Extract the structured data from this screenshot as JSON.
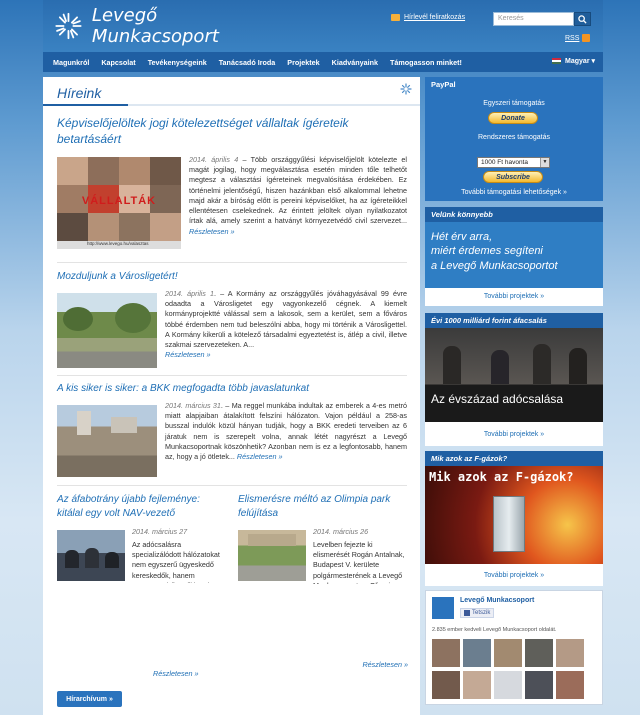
{
  "header": {
    "logo_text": "Levegő Munkacsoport",
    "newsletter": "Hírlevél feliratkozás",
    "search_placeholder": "Keresés",
    "rss": "RSS"
  },
  "nav": {
    "items": [
      "Magunkról",
      "Kapcsolat",
      "Tevékenységeink",
      "Tanácsadó Iroda",
      "Projektek",
      "Kiadványaink",
      "Támogasson minket!"
    ],
    "language": "Magyar ▾"
  },
  "main": {
    "title": "Híreink",
    "articles": [
      {
        "title": "Képviselőjelöltek jogi kötelezettséget vállaltak ígéreteik betartásáért",
        "date": "2014. április 4",
        "text": " – Több országgyűlési képviselőjelölt kötelezte el magát jogilag, hogy megválasztása esetén minden tőle telhetőt megtesz a választási ígéreteinek megvalósítása érdekében. Ez történelmi jelentőségű, hiszen hazánkban első alkalommal lehetne majd akár a bíróság előtt is pereini képviselőket, ha az ígéreteikkel ellentétesen cselekednek. Az érintett jelöltek olyan nyilatkozatot írtak alá, amely szerint a hatványt környezetvédő civil szervezet...",
        "more": "Részletesen »",
        "img_caption": "http://www.levego.hu/valasztas"
      },
      {
        "title": "Mozduljunk a Városligetért!",
        "date": "2014. április 1",
        "text": ". – A Kormány az országgyűlés jóváhagyásával 99 évre odaadta a Városligetet egy vagyonkezelő cégnek. A kiemelt kormányprojektté válással sem a lakosok, sem a kerület, sem a főváros többé érdemben nem tud beleszólni abba, hogy mi történik a Városligettel. A Kormány kikerüli a kötelező társadalmi egyeztetést is, átlép a civil, illetve szakmai szervezeteken. A...",
        "more": "Részletesen »"
      },
      {
        "title": "A kis siker is siker: a BKK megfogadta több javaslatunkat",
        "date": "2014. március 31",
        "text": ". – Ma reggel munkába indultak az emberek a 4-es metró miatt alapjaiban átalakított felszíni hálózaton. Vajon például a 258-as busszal indulók közül hányan tudják, hogy a BKK eredeti terveiben az 6 járatuk nem is szerepelt volna, annak létét nagyrészt a Levegő Munkacsoportnak köszönhetik? Azonban nem is ez a legfontosabb, hanem az, hogy a jó ötletek...",
        "more": "Részletesen »"
      },
      {
        "title": "Az áfabotrány újabb fejleménye: kitálal egy volt NAV-vezető",
        "date": "2014. március 27",
        "text": "Az adócsalásra specializálódott hálózatokat nem egyszerű ügyeskedő kereskedők, hanem szervezett bűnözői körök működtetik. Egyrészt folyamatosan keresik azokat a területeket, ahol alacsony kockázattal és nagy profittal forgathatják meg a tőkéjüket, másrészt mindent megtesznek azért, hogy gyengítsék a velük szemben fellépő állami szerveket – mondta el a...",
        "more": "Részletesen »"
      },
      {
        "title": "Elismerésre méltó az Olimpia park felújítása",
        "date": "2014. március 26",
        "text": "Levelben fejezte ki elismerését Rogán Antalnak, Budapest V. kerülete polgármesterének a Levegő Munkacsoport az Olimpia park és a Falk Miksa utca felújításáért. Az elmúlt tíz évben a civil szervezet sokszor tárgyalt az önkormányzat szakembereivel az Olimpia park védelméről, és üdvözli, hogy a korábbi elképzelés helyett, amely mélygarázs létesítését...",
        "more": "Részletesen »"
      }
    ],
    "archive_button": "Hírarchívum »"
  },
  "sidebar": {
    "paypal": {
      "heading": "PayPal",
      "one_time": "Egyszeri támogatás",
      "donate": "Donate",
      "recurring": "Rendszeres támogatás",
      "select_value": "1000 Ft havonta",
      "subscribe": "Subscribe",
      "more": "További támogatási lehetőségek »"
    },
    "velunk": {
      "heading": "Velünk könnyebb",
      "banner_lines": [
        "Hét érv arra,",
        "miért érdemes segíteni",
        "a Levegő Munkacsoportot"
      ],
      "link": "További projektek »"
    },
    "evi": {
      "heading": "Évi 1000 milliárd forint áfacsalás",
      "banner": "Az évszázad adócsalása",
      "link": "További projektek »"
    },
    "fgaz": {
      "heading": "Mik azok az F-gázok?",
      "banner": "Mik azok az F-gázok?",
      "link": "További projektek »"
    },
    "facebook": {
      "page_name": "Levegő Munkacsoport",
      "like": "Tetszik",
      "likes_text": "2.835 ember kedveli Levegő Munkacsoport oldalát."
    }
  },
  "colors": {
    "brand_blue": "#1f5fa3",
    "link_blue": "#1f6fb5",
    "button_blue": "#2a73bd"
  }
}
